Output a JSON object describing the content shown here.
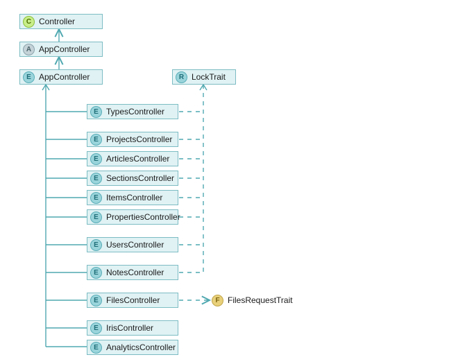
{
  "diagram": {
    "nodes": {
      "controller": {
        "badge": "C",
        "label": "Controller"
      },
      "app_controller_a": {
        "badge": "A",
        "label": "AppController"
      },
      "app_controller_e": {
        "badge": "E",
        "label": "AppController"
      },
      "lock_trait": {
        "badge": "R",
        "label": "LockTrait"
      },
      "types": {
        "badge": "E",
        "label": "TypesController"
      },
      "projects": {
        "badge": "E",
        "label": "ProjectsController"
      },
      "articles": {
        "badge": "E",
        "label": "ArticlesController"
      },
      "sections": {
        "badge": "E",
        "label": "SectionsController"
      },
      "items": {
        "badge": "E",
        "label": "ItemsController"
      },
      "properties": {
        "badge": "E",
        "label": "PropertiesController"
      },
      "users": {
        "badge": "E",
        "label": "UsersController"
      },
      "notes": {
        "badge": "E",
        "label": "NotesController"
      },
      "files": {
        "badge": "E",
        "label": "FilesController"
      },
      "iris": {
        "badge": "E",
        "label": "IrisController"
      },
      "analytics": {
        "badge": "E",
        "label": "AnalyticsController"
      },
      "files_trait": {
        "badge": "F",
        "label": "FilesRequestTrait"
      }
    },
    "edges": [
      {
        "from": "app_controller_a",
        "to": "controller",
        "style": "solid",
        "head": "open"
      },
      {
        "from": "app_controller_e",
        "to": "app_controller_a",
        "style": "solid",
        "head": "open"
      },
      {
        "from": "types",
        "to": "app_controller_e",
        "style": "solid",
        "head": "open"
      },
      {
        "from": "projects",
        "to": "app_controller_e",
        "style": "solid",
        "head": "open"
      },
      {
        "from": "articles",
        "to": "app_controller_e",
        "style": "solid",
        "head": "open"
      },
      {
        "from": "sections",
        "to": "app_controller_e",
        "style": "solid",
        "head": "open"
      },
      {
        "from": "items",
        "to": "app_controller_e",
        "style": "solid",
        "head": "open"
      },
      {
        "from": "properties",
        "to": "app_controller_e",
        "style": "solid",
        "head": "open"
      },
      {
        "from": "users",
        "to": "app_controller_e",
        "style": "solid",
        "head": "open"
      },
      {
        "from": "notes",
        "to": "app_controller_e",
        "style": "solid",
        "head": "open"
      },
      {
        "from": "files",
        "to": "app_controller_e",
        "style": "solid",
        "head": "open"
      },
      {
        "from": "iris",
        "to": "app_controller_e",
        "style": "solid",
        "head": "open"
      },
      {
        "from": "analytics",
        "to": "app_controller_e",
        "style": "solid",
        "head": "open"
      },
      {
        "from": "types",
        "to": "lock_trait",
        "style": "dashed",
        "head": "open"
      },
      {
        "from": "projects",
        "to": "lock_trait",
        "style": "dashed",
        "head": "open"
      },
      {
        "from": "articles",
        "to": "lock_trait",
        "style": "dashed",
        "head": "open"
      },
      {
        "from": "sections",
        "to": "lock_trait",
        "style": "dashed",
        "head": "open"
      },
      {
        "from": "items",
        "to": "lock_trait",
        "style": "dashed",
        "head": "open"
      },
      {
        "from": "properties",
        "to": "lock_trait",
        "style": "dashed",
        "head": "open"
      },
      {
        "from": "users",
        "to": "lock_trait",
        "style": "dashed",
        "head": "open"
      },
      {
        "from": "notes",
        "to": "lock_trait",
        "style": "dashed",
        "head": "open"
      },
      {
        "from": "files",
        "to": "files_trait",
        "style": "dashed",
        "head": "open"
      }
    ]
  }
}
